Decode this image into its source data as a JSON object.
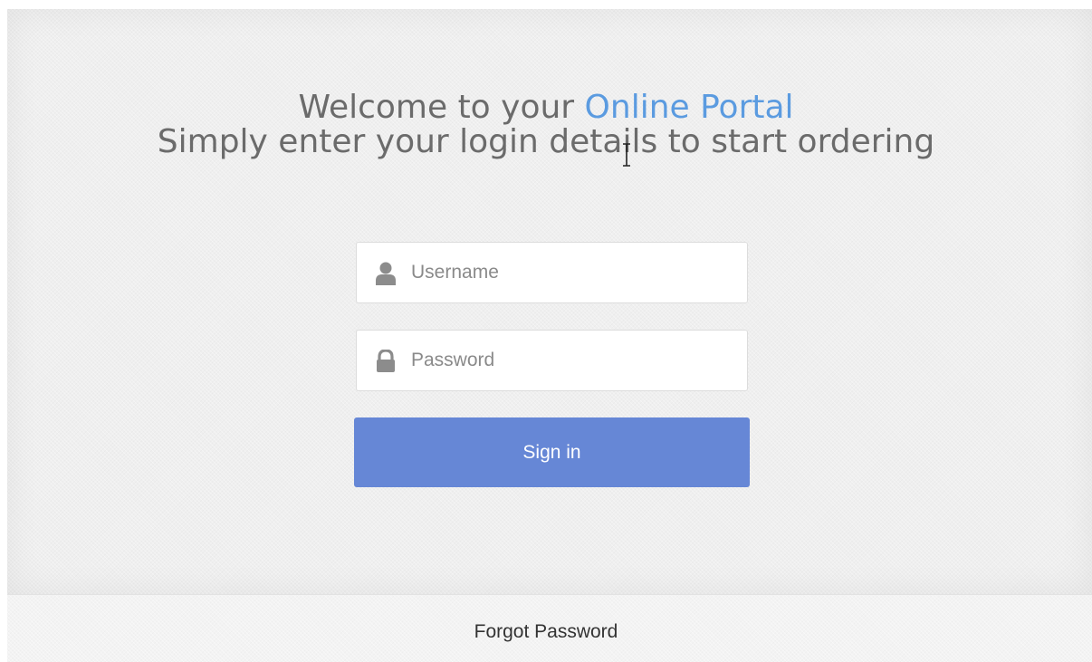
{
  "header": {
    "line1_prefix": "Welcome to your ",
    "line1_accent": "Online Portal",
    "line2": "Simply enter your login details to start ordering"
  },
  "form": {
    "username": {
      "placeholder": "Username",
      "value": "",
      "icon": "user-icon"
    },
    "password": {
      "placeholder": "Password",
      "value": "",
      "icon": "lock-icon"
    },
    "signin_label": "Sign in"
  },
  "footer": {
    "forgot_label": "Forgot Password"
  },
  "colors": {
    "accent": "#5b9be0",
    "button": "#6687d6",
    "heading": "#6b6b6b"
  }
}
